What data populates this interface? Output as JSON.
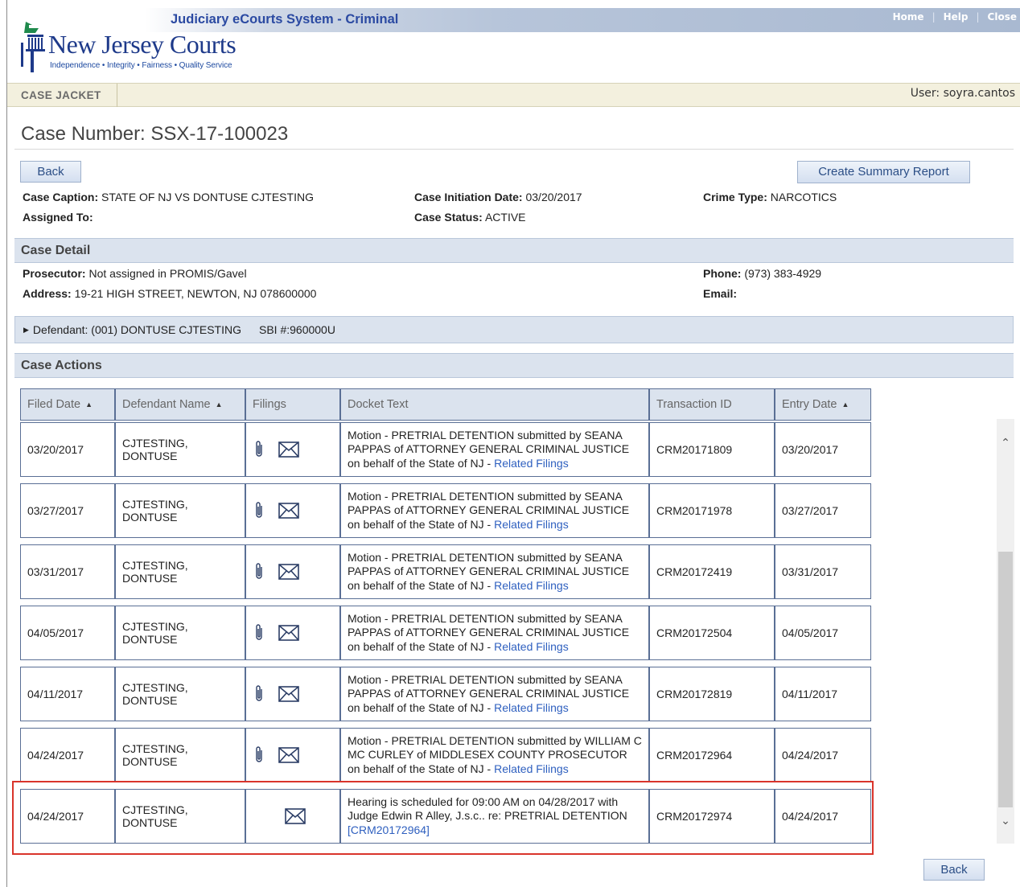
{
  "header": {
    "system_title": "Judiciary eCourts System - Criminal",
    "links": [
      "Home",
      "Help",
      "Close"
    ],
    "logo_text": "New Jersey Courts",
    "logo_tagline": "Independence • Integrity • Fairness • Quality Service"
  },
  "nav": {
    "tab": "CASE JACKET",
    "user": "User: soyra.cantos"
  },
  "case": {
    "number_label": "Case Number: SSX-17-100023",
    "back_label": "Back",
    "summary_label": "Create Summary Report",
    "caption_label": "Case Caption:",
    "caption_value": "STATE OF NJ VS DONTUSE CJTESTING",
    "assigned_label": "Assigned To:",
    "initiation_label": "Case Initiation Date:",
    "initiation_value": "03/20/2017",
    "status_label": "Case Status:",
    "status_value": "ACTIVE",
    "crime_label": "Crime Type:",
    "crime_value": "NARCOTICS"
  },
  "detail": {
    "section_title": "Case Detail",
    "prosecutor_label": "Prosecutor:",
    "prosecutor_value": "Not assigned in PROMIS/Gavel",
    "address_label": "Address:",
    "address_value": "19-21 HIGH STREET, NEWTON, NJ 078600000",
    "phone_label": "Phone:",
    "phone_value": "(973) 383-4929",
    "email_label": "Email:"
  },
  "defendant": {
    "label": "Defendant: (001) DONTUSE CJTESTING",
    "sbi": "SBI #:960000U"
  },
  "actions": {
    "section_title": "Case Actions",
    "columns": [
      "Filed Date",
      "Defendant Name",
      "Filings",
      "Docket Text",
      "Transaction ID",
      "Entry Date"
    ],
    "rows": [
      {
        "filed": "03/20/2017",
        "name1": "CJTESTING,",
        "name2": "DONTUSE",
        "docket": "Motion - PRETRIAL DETENTION submitted by SEANA PAPPAS of ATTORNEY GENERAL CRIMINAL JUSTICE on behalf of the State of NJ - ",
        "link": "Related Filings",
        "txn": "CRM20171809",
        "entry": "03/20/2017"
      },
      {
        "filed": "03/27/2017",
        "name1": "CJTESTING,",
        "name2": "DONTUSE",
        "docket": "Motion - PRETRIAL DETENTION submitted by SEANA PAPPAS of ATTORNEY GENERAL CRIMINAL JUSTICE on behalf of the State of NJ - ",
        "link": "Related Filings",
        "txn": "CRM20171978",
        "entry": "03/27/2017"
      },
      {
        "filed": "03/31/2017",
        "name1": "CJTESTING,",
        "name2": "DONTUSE",
        "docket": "Motion - PRETRIAL DETENTION submitted by SEANA PAPPAS of ATTORNEY GENERAL CRIMINAL JUSTICE on behalf of the State of NJ - ",
        "link": "Related Filings",
        "txn": "CRM20172419",
        "entry": "03/31/2017"
      },
      {
        "filed": "04/05/2017",
        "name1": "CJTESTING,",
        "name2": "DONTUSE",
        "docket": "Motion - PRETRIAL DETENTION submitted by SEANA PAPPAS of ATTORNEY GENERAL CRIMINAL JUSTICE on behalf of the State of NJ - ",
        "link": "Related Filings",
        "txn": "CRM20172504",
        "entry": "04/05/2017"
      },
      {
        "filed": "04/11/2017",
        "name1": "CJTESTING,",
        "name2": "DONTUSE",
        "docket": "Motion - PRETRIAL DETENTION submitted by SEANA PAPPAS of ATTORNEY GENERAL CRIMINAL JUSTICE on behalf of the State of NJ - ",
        "link": "Related Filings",
        "txn": "CRM20172819",
        "entry": "04/11/2017"
      },
      {
        "filed": "04/24/2017",
        "name1": "CJTESTING,",
        "name2": "DONTUSE",
        "docket": "Motion - PRETRIAL DETENTION submitted by WILLIAM C MC CURLEY of MIDDLESEX COUNTY PROSECUTOR on behalf of the State of NJ - ",
        "link": "Related Filings",
        "txn": "CRM20172964",
        "entry": "04/24/2017"
      },
      {
        "filed": "04/24/2017",
        "name1": "CJTESTING,",
        "name2": "DONTUSE",
        "docket": "Hearing is scheduled for 09:00 AM on 04/28/2017 with Judge Edwin R Alley, J.s.c.. re: PRETRIAL DETENTION ",
        "link": "[CRM20172964]",
        "txn": "CRM20172974",
        "entry": "04/24/2017"
      }
    ]
  },
  "bottom": {
    "back_label": "Back"
  },
  "colors": {
    "accent": "#2b4aa2",
    "highlight": "#d9342b",
    "section_bg": "#dbe3ee"
  }
}
